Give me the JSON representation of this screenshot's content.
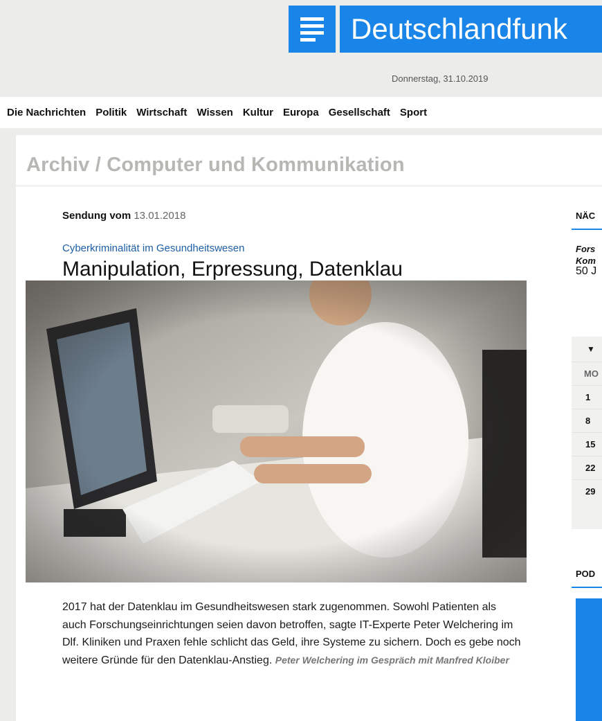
{
  "brand": {
    "name": "Deutschlandfunk",
    "color": "#1a85e8"
  },
  "header": {
    "date": "Donnerstag, 31.10.2019"
  },
  "nav": {
    "items": [
      "Die Nachrichten",
      "Politik",
      "Wirtschaft",
      "Wissen",
      "Kultur",
      "Europa",
      "Gesellschaft",
      "Sport"
    ]
  },
  "page": {
    "section_title": "Archiv / Computer und Kommunikation"
  },
  "article": {
    "sendung_label": "Sendung vom ",
    "sendung_date": "13.01.2018",
    "kicker": "Cyberkriminalität im Gesundheitswesen",
    "headline": "Manipulation, Erpressung, Datenklau",
    "teaser": "2017 hat der Datenklau im Gesundheitswesen stark zugenommen. Sowohl Patienten als auch Forschungseinrichtungen seien davon betroffen, sagte IT-Experte Peter Welchering im Dlf. Kliniken und Praxen fehle schlicht das Geld, ihre Systeme zu sichern. Doch es gebe noch weitere Gründe für den Datenklau-Anstieg.",
    "byline": "Peter Welchering im Gespräch mit Manfred Kloiber"
  },
  "sidebar": {
    "next_heading": "NÄC",
    "next_title_line1": "Fors",
    "next_title_line2": "Kom",
    "next_text": "50 J",
    "calendar": {
      "toggle_icon": "▼",
      "day_header": "MO",
      "days": [
        "1",
        "8",
        "15",
        "22",
        "29"
      ]
    },
    "podcast_heading": "POD"
  }
}
